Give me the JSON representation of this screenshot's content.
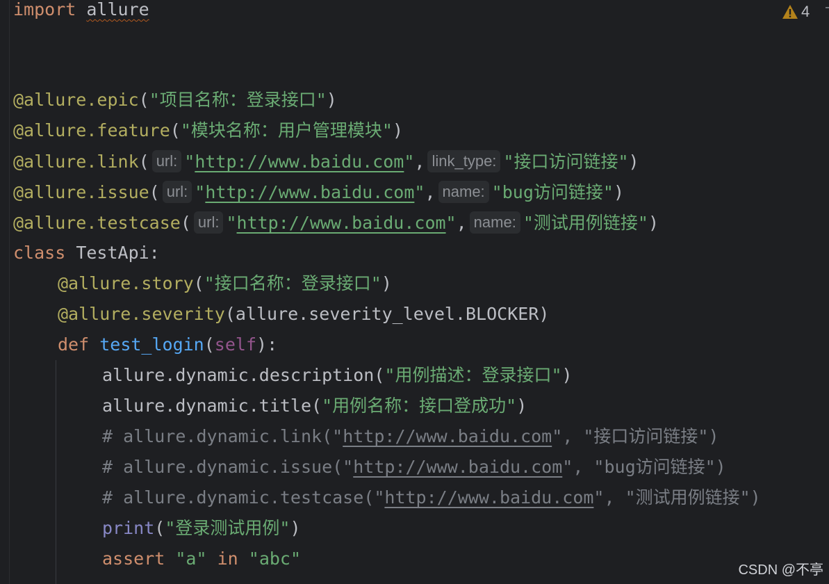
{
  "inspection": {
    "warning_count": "4",
    "icon": "warning-triangle-icon",
    "color": "#b3821b"
  },
  "code": {
    "l1": {
      "kw": "import",
      "module": "allure"
    },
    "l4": {
      "deco": "@allure.epic",
      "open": "(",
      "str": "\"项目名称：登录接口\"",
      "close": ")"
    },
    "l5": {
      "deco": "@allure.feature",
      "open": "(",
      "str": "\"模块名称：用户管理模块\"",
      "close": ")"
    },
    "l6": {
      "deco": "@allure.link",
      "open": "(",
      "hint1": "url:",
      "q1": "\"",
      "url": "http://www.baidu.com",
      "q2": "\"",
      "comma": ",",
      "hint2": "link_type:",
      "str2": "\"接口访问链接\"",
      "close": ")"
    },
    "l7": {
      "deco": "@allure.issue",
      "open": "(",
      "hint1": "url:",
      "q1": "\"",
      "url": "http://www.baidu.com",
      "q2": "\"",
      "comma": ",",
      "hint2": "name:",
      "str2": "\"bug访问链接\"",
      "close": ")"
    },
    "l8": {
      "deco": "@allure.testcase",
      "open": "(",
      "hint1": "url:",
      "q1": "\"",
      "url": "http://www.baidu.com",
      "q2": "\"",
      "comma": ",",
      "hint2": "name:",
      "str2": "\"测试用例链接\"",
      "close": ")"
    },
    "l9": {
      "kw": "class",
      "rest": " TestApi:"
    },
    "l10": {
      "deco": "@allure.story",
      "open": "(",
      "str": "\"接口名称：登录接口\"",
      "close": ")"
    },
    "l11": {
      "deco": "@allure.severity",
      "rest": "(allure.severity_level.BLOCKER)"
    },
    "l12": {
      "kw": "def",
      "fn": "test_login",
      "open": "(",
      "self": "self",
      "close": "):"
    },
    "l13": {
      "call": "allure.dynamic.description",
      "open": "(",
      "str": "\"用例描述：登录接口\"",
      "close": ")"
    },
    "l14": {
      "call": "allure.dynamic.title",
      "open": "(",
      "str": "\"用例名称：接口登成功\"",
      "close": ")"
    },
    "l15": {
      "pre": "# allure.dynamic.link(\"",
      "url": "http://www.baidu.com",
      "post": "\", \"接口访问链接\")"
    },
    "l16": {
      "pre": "# allure.dynamic.issue(\"",
      "url": "http://www.baidu.com",
      "post": "\", \"bug访问链接\")"
    },
    "l17": {
      "pre": "# allure.dynamic.testcase(\"",
      "url": "http://www.baidu.com",
      "post": "\", \"测试用例链接\")"
    },
    "l18": {
      "builtin": "print",
      "open": "(",
      "str": "\"登录测试用例\"",
      "close": ")"
    },
    "l19": {
      "kw": "assert",
      "s1": "\"a\"",
      "kw2": "in",
      "s2": "\"abc\""
    }
  },
  "watermark": "CSDN @不亭",
  "colors": {
    "background": "#1e1f22",
    "keyword": "#cf8e6d",
    "decorator": "#b3ae60",
    "string": "#6aab73",
    "function": "#56a8f5",
    "comment": "#7a7e85"
  }
}
